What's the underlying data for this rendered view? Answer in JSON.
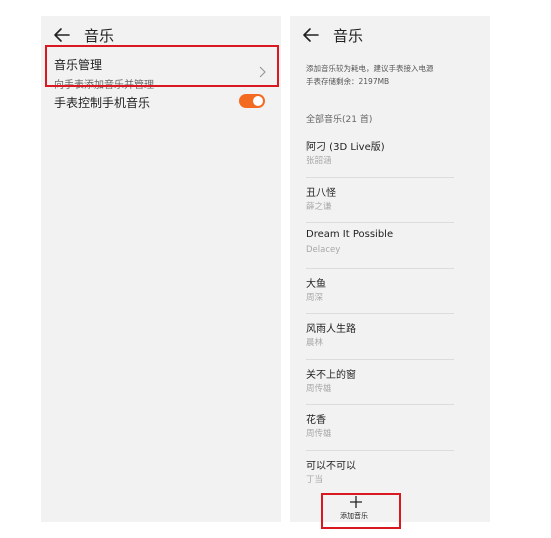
{
  "left": {
    "title": "音乐",
    "music_management": {
      "label": "音乐管理",
      "sublabel": "向手表添加音乐并管理"
    },
    "watch_control": {
      "label": "手表控制手机音乐",
      "enabled": true
    }
  },
  "right": {
    "title": "音乐",
    "info_line1": "添加音乐较为耗电，建议手表接入电源",
    "info_line2": "手表存储剩余：2197MB",
    "section_label": "全部音乐(21 首)",
    "songs": [
      {
        "name": "阿刁 (3D Live版)",
        "artist": "张韶涵"
      },
      {
        "name": "丑八怪",
        "artist": "薛之谦"
      },
      {
        "name": "Dream It Possible",
        "artist": "Delacey"
      },
      {
        "name": "大鱼",
        "artist": "周深"
      },
      {
        "name": "风雨人生路",
        "artist": "晨林"
      },
      {
        "name": "关不上的窗",
        "artist": "周传雄"
      },
      {
        "name": "花香",
        "artist": "周传雄"
      },
      {
        "name": "可以不可以",
        "artist": "丁当"
      }
    ],
    "add_button": "添加音乐"
  },
  "colors": {
    "accent": "#f26b21",
    "highlight": "#d9181f"
  }
}
